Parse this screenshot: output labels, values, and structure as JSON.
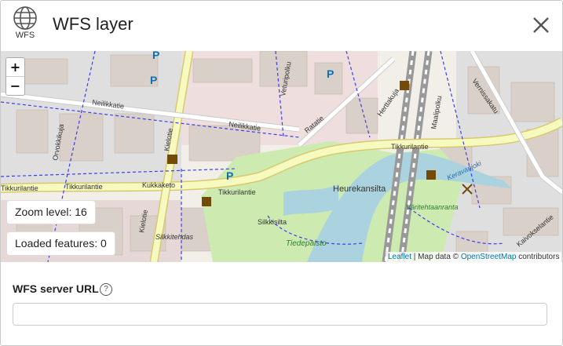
{
  "header": {
    "icon": "globe-icon",
    "icon_label": "WFS",
    "title": "WFS layer",
    "close_icon": "close-icon"
  },
  "map": {
    "zoom_in": "+",
    "zoom_out": "−",
    "labels": {
      "neilikkatie_1": "Neilikkatie",
      "neilikkatie_2": "Neilikkatie",
      "ratatie": "Ratatie",
      "tikkurilantie_1": "Tikkurilantie",
      "tikkurilantie_2": "Tikkurilantie",
      "tikkurilantie_3": "Tikkurilantie",
      "kukkaketo": "Kukkaketo",
      "heurekansilta": "Heurekansilta",
      "silkkisilta": "Silkkisilta",
      "tiedepaisto": "Tiedepaisto",
      "silkkitehdas": "Silkkitehdas",
      "keravanjoki": "Keravanjoki",
      "varitehtaanranta": "Väritehtaanranta",
      "kielotie_1": "Kielotie",
      "kielotie_2": "Kielotie",
      "orvokkikuja": "Orvokkikuja",
      "vernissakatu": "Vernissakatu",
      "herttakuja": "Herttakuja",
      "veturipolku": "Veturipolku",
      "maalipolku": "Maalipolku",
      "kaivokselantie": "Kaivokselantie"
    },
    "parking": "P"
  },
  "status": {
    "zoom_level": "Zoom level: 16",
    "loaded_features": "Loaded features: 0"
  },
  "attribution": {
    "leaflet": "Leaflet",
    "sep": " | Map data © ",
    "osm": "OpenStreetMap",
    "suffix": " contributors"
  },
  "form": {
    "url_label": "WFS server URL",
    "help_icon": "?",
    "url_value": "",
    "url_placeholder": ""
  },
  "colors": {
    "road_major": "#f7fabf",
    "road_major_edge": "#d8c96f",
    "park": "#cdebb0",
    "water": "#aad3df",
    "building": "#d9d0c9",
    "residential": "#e0dfdf",
    "footway": "#3d3df0",
    "link": "#0078a8"
  }
}
